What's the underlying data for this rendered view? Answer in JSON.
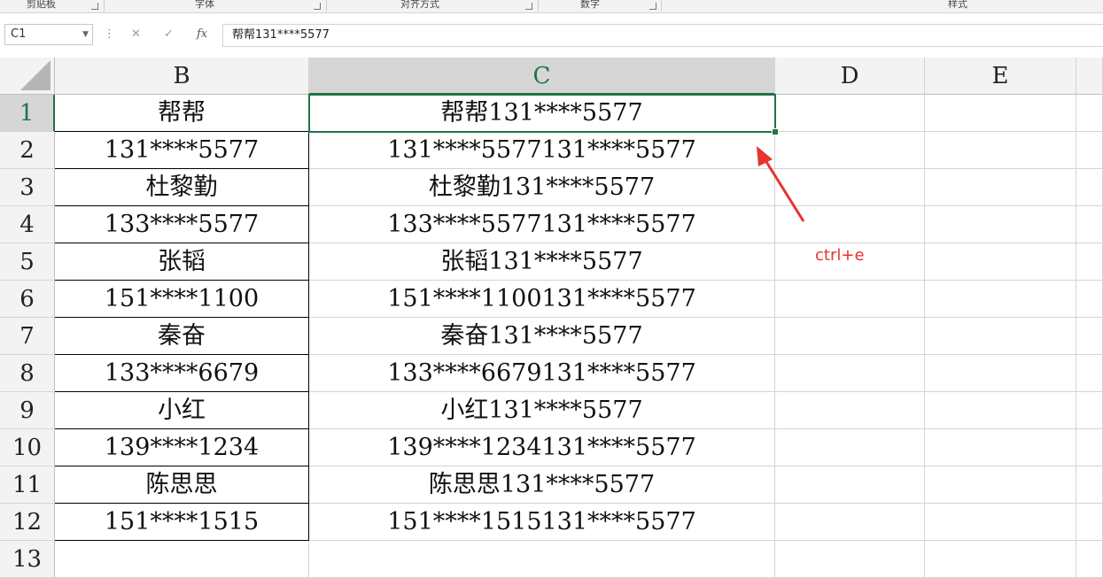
{
  "ribbon": {
    "groups": [
      "剪贴板",
      "字体",
      "对齐方式",
      "数字",
      "样式"
    ]
  },
  "formula_bar": {
    "name_box": "C1",
    "cancel_icon": "✕",
    "enter_icon": "✓",
    "fx_label": "fx",
    "content": "帮帮131****5577"
  },
  "sheet": {
    "columns": [
      "B",
      "C",
      "D",
      "E"
    ],
    "selected_column": "C",
    "selected_row": "1",
    "rows": [
      {
        "row": "1",
        "b": "帮帮",
        "c": "帮帮131****5577"
      },
      {
        "row": "2",
        "b": "131****5577",
        "c": "131****5577131****5577"
      },
      {
        "row": "3",
        "b": "杜黎勤",
        "c": "杜黎勤131****5577"
      },
      {
        "row": "4",
        "b": "133****5577",
        "c": "133****5577131****5577"
      },
      {
        "row": "5",
        "b": "张韬",
        "c": "张韬131****5577"
      },
      {
        "row": "6",
        "b": "151****1100",
        "c": "151****1100131****5577"
      },
      {
        "row": "7",
        "b": "秦奋",
        "c": "秦奋131****5577"
      },
      {
        "row": "8",
        "b": "133****6679",
        "c": "133****6679131****5577"
      },
      {
        "row": "9",
        "b": "小红",
        "c": "小红131****5577"
      },
      {
        "row": "10",
        "b": "139****1234",
        "c": "139****1234131****5577"
      },
      {
        "row": "11",
        "b": "陈思思",
        "c": "陈思思131****5577"
      },
      {
        "row": "12",
        "b": "151****1515",
        "c": "151****1515131****5577"
      },
      {
        "row": "13",
        "b": "",
        "c": ""
      }
    ]
  },
  "annotation": {
    "text": "ctrl+e",
    "color": "#e8322f"
  },
  "colors": {
    "accent": "#217346"
  }
}
